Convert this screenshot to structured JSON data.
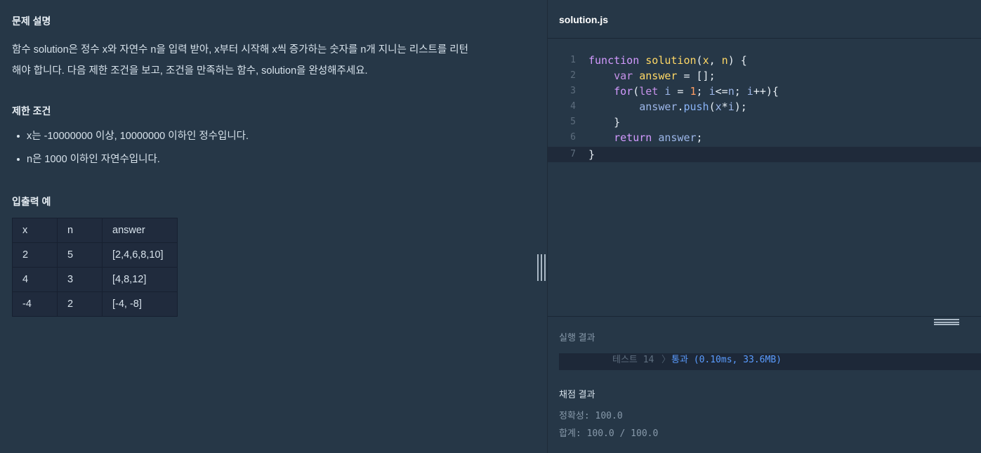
{
  "problem": {
    "section_title": "문제 설명",
    "description_line1": "함수 solution은 정수 x와 자연수 n을 입력 받아, x부터 시작해 x씩 증가하는 숫자를 n개 지니는 리스트를 리턴",
    "description_line2": "해야 합니다. 다음 제한 조건을 보고, 조건을 만족하는 함수, solution을 완성해주세요.",
    "constraints_title": "제한 조건",
    "constraints": [
      "x는 -10000000 이상, 10000000 이하인 정수입니다.",
      "n은 1000 이하인 자연수입니다."
    ],
    "examples_title": "입출력 예",
    "examples_table": {
      "headers": [
        "x",
        "n",
        "answer"
      ],
      "rows": [
        [
          "2",
          "5",
          "[2,4,6,8,10]"
        ],
        [
          "4",
          "3",
          "[4,8,12]"
        ],
        [
          "-4",
          "2",
          "[-4, -8]"
        ]
      ]
    }
  },
  "editor": {
    "file_name": "solution.js",
    "line_numbers": [
      "1",
      "2",
      "3",
      "4",
      "5",
      "6",
      "7"
    ],
    "code_lines": [
      "function solution(x, n) {",
      "    var answer = [];",
      "    for(let i = 1; i<=n; i++){",
      "        answer.push(x*i);",
      "    }",
      "    return answer;",
      "}"
    ]
  },
  "console": {
    "result_title": "실행 결과",
    "test_label": "테스트 14",
    "test_chevron": "〉",
    "test_result": "통과 (0.10ms, 33.6MB)",
    "grade_title": "채점 결과",
    "accuracy": "정확성: 100.0",
    "total": "합계: 100.0 / 100.0"
  },
  "colors": {
    "background": "#263747",
    "keyword": "#d39aff",
    "function_name": "#ffd866",
    "pass": "#5a9cff"
  }
}
